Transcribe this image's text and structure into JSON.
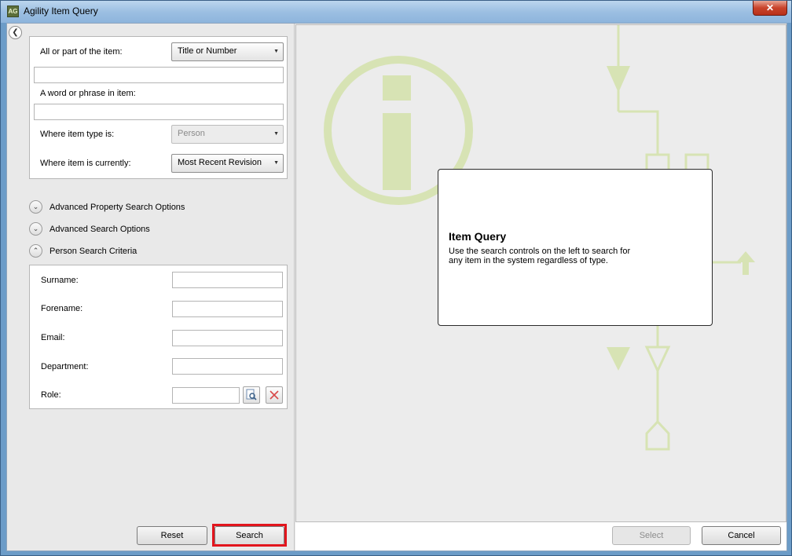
{
  "window": {
    "title": "Agility Item Query",
    "icon_text": "AG",
    "close_symbol": "✕"
  },
  "search": {
    "item_label": "All or part of the item:",
    "item_mode": "Title or Number",
    "item_value": "",
    "phrase_label": "A word or phrase in item:",
    "phrase_value": "",
    "type_label": "Where item type is:",
    "type_value": "Person",
    "current_label": "Where item is currently:",
    "current_value": "Most Recent Revision"
  },
  "sections": {
    "advanced_property": "Advanced Property Search Options",
    "advanced_search": "Advanced Search Options",
    "person_criteria": "Person Search Criteria"
  },
  "person": {
    "surname_label": "Surname:",
    "forename_label": "Forename:",
    "email_label": "Email:",
    "department_label": "Department:",
    "role_label": "Role:"
  },
  "buttons": {
    "reset": "Reset",
    "search": "Search",
    "select": "Select",
    "cancel": "Cancel"
  },
  "info": {
    "title": "Item Query",
    "description": "Use the search controls on the left to search for any item in the system regardless of type."
  },
  "colors": {
    "accent_green": "#d7e3b4",
    "highlight_red": "#e2151d",
    "title_bar": "#9cbfe2"
  },
  "icons": {
    "collapse": "chevron-left-icon",
    "expand": "chevron-down-icon",
    "collapse_section": "chevron-up-icon",
    "role_lookup": "search-document-icon",
    "role_clear": "clear-x-icon"
  }
}
